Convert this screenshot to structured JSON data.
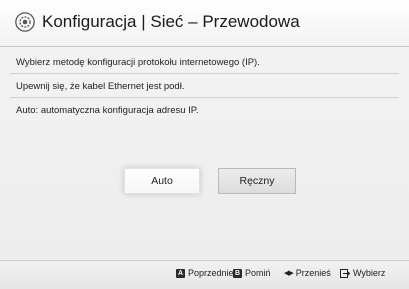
{
  "header": {
    "title": "Konfiguracja | Sieć – Przewodowa",
    "icon": "gear-icon"
  },
  "lines": {
    "choose_method": "Wybierz metodę konfiguracji protokołu internetowego (IP).",
    "cable_check": "Upewnij się, że kabel Ethernet jest podł.",
    "description": "Auto: automatyczna konfiguracja adresu IP."
  },
  "buttons": {
    "auto": "Auto",
    "manual": "Ręczny",
    "selected": "Auto"
  },
  "footer": {
    "previous": {
      "key": "A",
      "label": "Poprzednie"
    },
    "skip": {
      "key": "B",
      "label": "Pomiń"
    },
    "move": {
      "icon": "left-right-arrows-icon",
      "label": "Przenieś"
    },
    "select": {
      "icon": "enter-return-icon",
      "label": "Wybierz"
    }
  }
}
